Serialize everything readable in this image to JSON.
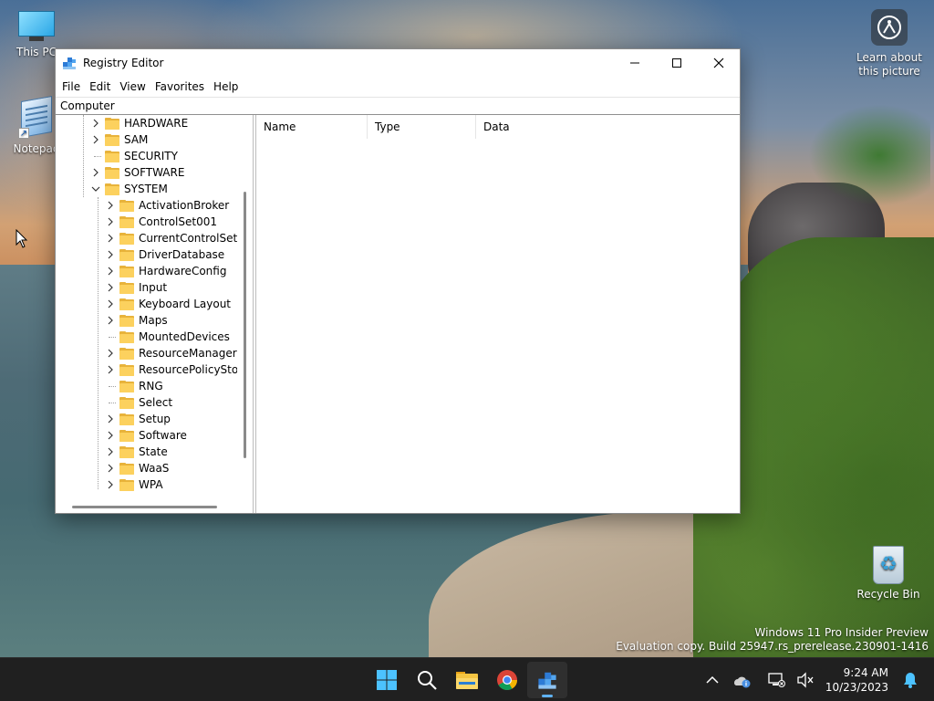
{
  "desktop": {
    "icons": [
      {
        "label": "This PC"
      },
      {
        "label": "Notepad"
      },
      {
        "label": "Recycle Bin"
      }
    ],
    "learn_about": "Learn about this picture",
    "watermark": {
      "line1": "Windows 11 Pro Insider Preview",
      "line2": "Evaluation copy. Build 25947.rs_prerelease.230901-1416"
    }
  },
  "window": {
    "title": "Registry Editor",
    "menu": [
      "File",
      "Edit",
      "View",
      "Favorites",
      "Help"
    ],
    "address": "Computer",
    "tree": [
      {
        "label": "HARDWARE",
        "level": 1,
        "expander": "collapsed"
      },
      {
        "label": "SAM",
        "level": 1,
        "expander": "collapsed"
      },
      {
        "label": "SECURITY",
        "level": 1,
        "expander": "none"
      },
      {
        "label": "SOFTWARE",
        "level": 1,
        "expander": "collapsed"
      },
      {
        "label": "SYSTEM",
        "level": 1,
        "expander": "expanded"
      },
      {
        "label": "ActivationBroker",
        "level": 2,
        "expander": "collapsed"
      },
      {
        "label": "ControlSet001",
        "level": 2,
        "expander": "collapsed"
      },
      {
        "label": "CurrentControlSet",
        "level": 2,
        "expander": "collapsed"
      },
      {
        "label": "DriverDatabase",
        "level": 2,
        "expander": "collapsed"
      },
      {
        "label": "HardwareConfig",
        "level": 2,
        "expander": "collapsed"
      },
      {
        "label": "Input",
        "level": 2,
        "expander": "collapsed"
      },
      {
        "label": "Keyboard Layout",
        "level": 2,
        "expander": "collapsed"
      },
      {
        "label": "Maps",
        "level": 2,
        "expander": "collapsed"
      },
      {
        "label": "MountedDevices",
        "level": 2,
        "expander": "none"
      },
      {
        "label": "ResourceManager",
        "level": 2,
        "expander": "collapsed"
      },
      {
        "label": "ResourcePolicyStore",
        "level": 2,
        "expander": "collapsed"
      },
      {
        "label": "RNG",
        "level": 2,
        "expander": "none"
      },
      {
        "label": "Select",
        "level": 2,
        "expander": "none"
      },
      {
        "label": "Setup",
        "level": 2,
        "expander": "collapsed"
      },
      {
        "label": "Software",
        "level": 2,
        "expander": "collapsed"
      },
      {
        "label": "State",
        "level": 2,
        "expander": "collapsed"
      },
      {
        "label": "WaaS",
        "level": 2,
        "expander": "collapsed"
      },
      {
        "label": "WPA",
        "level": 2,
        "expander": "collapsed"
      }
    ],
    "columns": [
      "Name",
      "Type",
      "Data"
    ]
  },
  "taskbar": {
    "apps": [
      {
        "name": "start-button"
      },
      {
        "name": "search-button"
      },
      {
        "name": "file-explorer-button"
      },
      {
        "name": "chrome-button"
      },
      {
        "name": "registry-editor-button"
      }
    ],
    "time": "9:24 AM",
    "date": "10/23/2023"
  },
  "colors": {
    "taskbar": "#202020",
    "folder": "#fcd15e",
    "accent": "#5fb2f2"
  }
}
